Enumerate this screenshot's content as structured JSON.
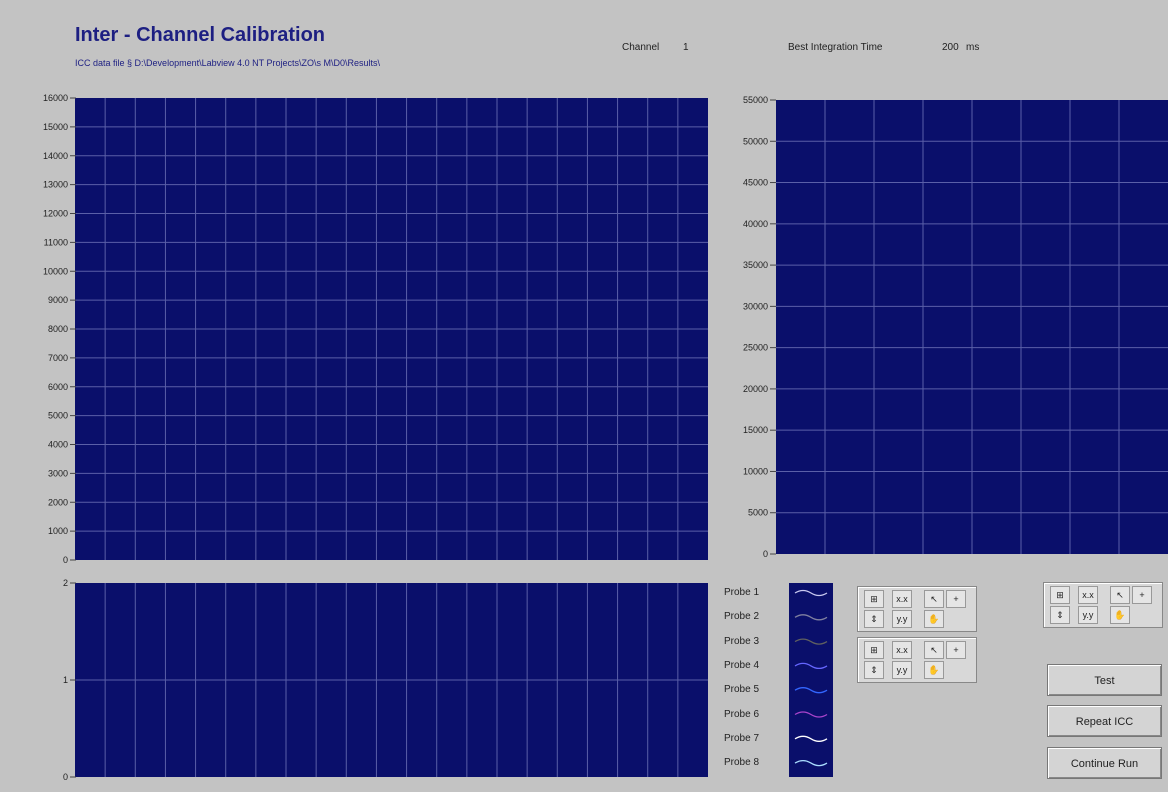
{
  "header": {
    "title": "Inter - Channel Calibration",
    "file_label": "ICC data file",
    "file_path": "§ D:\\Development\\Labview 4.0 NT Projects\\ZO\\s M\\D0\\Results\\",
    "channel_label": "Channel",
    "channel_value": "1",
    "integration_label": "Best Integration Time",
    "integration_value": "200",
    "integration_unit": "ms"
  },
  "graphs": {
    "main": {
      "y_ticks": [
        "16000",
        "15000",
        "14000",
        "13000",
        "12000",
        "11000",
        "10000",
        "9000",
        "8000",
        "7000",
        "6000",
        "5000",
        "4000",
        "3000",
        "2000",
        "1000",
        "0"
      ]
    },
    "right": {
      "y_ticks": [
        "55000",
        "50000",
        "45000",
        "40000",
        "35000",
        "30000",
        "25000",
        "20000",
        "15000",
        "10000",
        "5000",
        "0"
      ]
    },
    "bottom": {
      "y_ticks": [
        "2",
        "1",
        "0"
      ]
    }
  },
  "legend": {
    "probes": [
      "Probe 1",
      "Probe 2",
      "Probe 3",
      "Probe 4",
      "Probe 5",
      "Probe 6",
      "Probe 7",
      "Probe 8"
    ],
    "colors": [
      "#c8c8f0",
      "#8080a0",
      "#606060",
      "#6666ff",
      "#3366ff",
      "#aa44cc",
      "#ffffff",
      "#aaddff"
    ]
  },
  "palette_icons": [
    "zoom-icon",
    "pan-icon",
    "cursor-icon",
    "plus-icon",
    "format-x-icon",
    "format-y-icon",
    "hand-icon"
  ],
  "buttons": {
    "test": "Test",
    "repeat": "Repeat ICC",
    "continue": "Continue Run"
  }
}
